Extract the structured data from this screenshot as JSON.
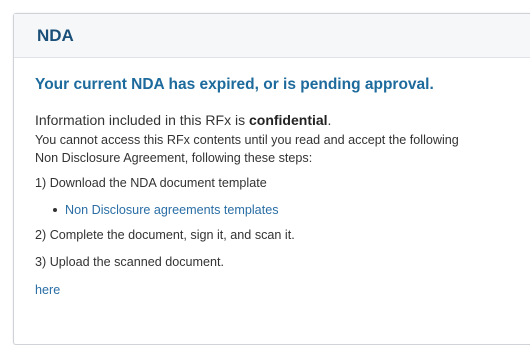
{
  "panel": {
    "title": "NDA"
  },
  "warning": {
    "heading": "Your current NDA has expired, or is pending approval."
  },
  "confidential": {
    "prefix": "Information included in this RFx is ",
    "emphasis": "confidential",
    "suffix": "."
  },
  "intro": {
    "line1": "You cannot access this RFx contents until you read and accept the following",
    "line2": "Non Disclosure Agreement, following these steps:"
  },
  "steps": {
    "step1": "1) Download the NDA document template",
    "template_link": "Non Disclosure agreements templates",
    "step2": "2) Complete the document, sign it, and scan it.",
    "step3": "3) Upload the scanned document."
  },
  "upload": {
    "link_label": "here"
  },
  "colors": {
    "title": "#1a4f79",
    "heading": "#1d6a9c",
    "link": "#2a6ea5",
    "text": "#333333"
  }
}
